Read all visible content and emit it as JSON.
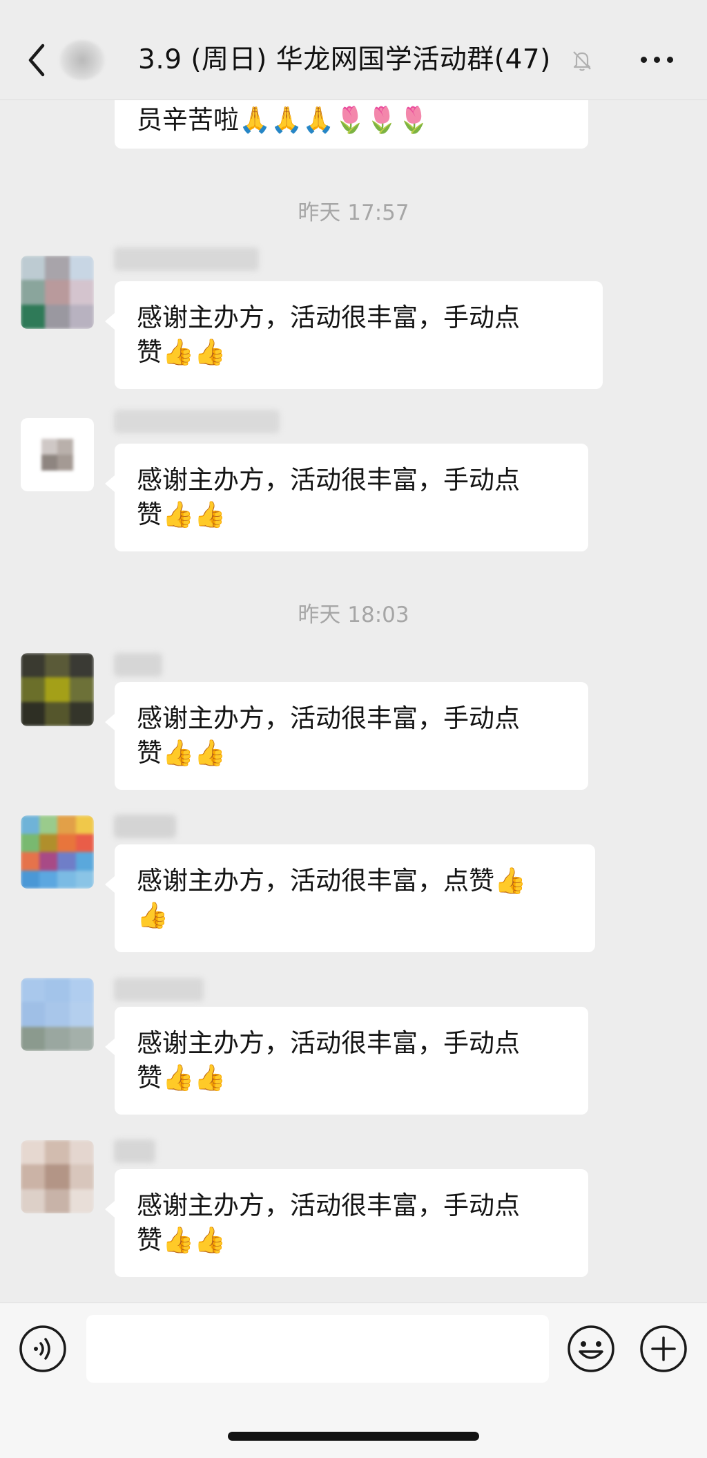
{
  "header": {
    "title": "3.9 (周日) 华龙网国学活动群(47)"
  },
  "chat": {
    "top_partial_message": "员辛苦啦🙏🙏🙏🌷🌷🌷",
    "timestamps": [
      "昨天 17:57",
      "昨天 18:03"
    ],
    "messages": [
      {
        "line1": "  感谢主办方，活动很丰富，手动点",
        "line2": "赞👍👍"
      },
      {
        "line1": "感谢主办方，活动很丰富，手动点",
        "line2": "赞👍👍"
      },
      {
        "line1": "感谢主办方，活动很丰富，手动点",
        "line2": "赞👍👍"
      },
      {
        "line1": "感谢主办方，活动很丰富，点赞👍",
        "line2": "👍"
      },
      {
        "line1": "感谢主办方，活动很丰富，手动点",
        "line2": "赞👍👍"
      },
      {
        "line1": "感谢主办方，活动很丰富，手动点",
        "line2": "赞👍👍"
      }
    ]
  },
  "input_bar": {
    "message_value": "",
    "icons": {
      "voice": "voice-icon",
      "emoji": "emoji-icon",
      "plus": "plus-icon"
    }
  },
  "colors": {
    "background": "#ededed",
    "bubble": "#ffffff",
    "timestamp": "#a6a6a6"
  }
}
